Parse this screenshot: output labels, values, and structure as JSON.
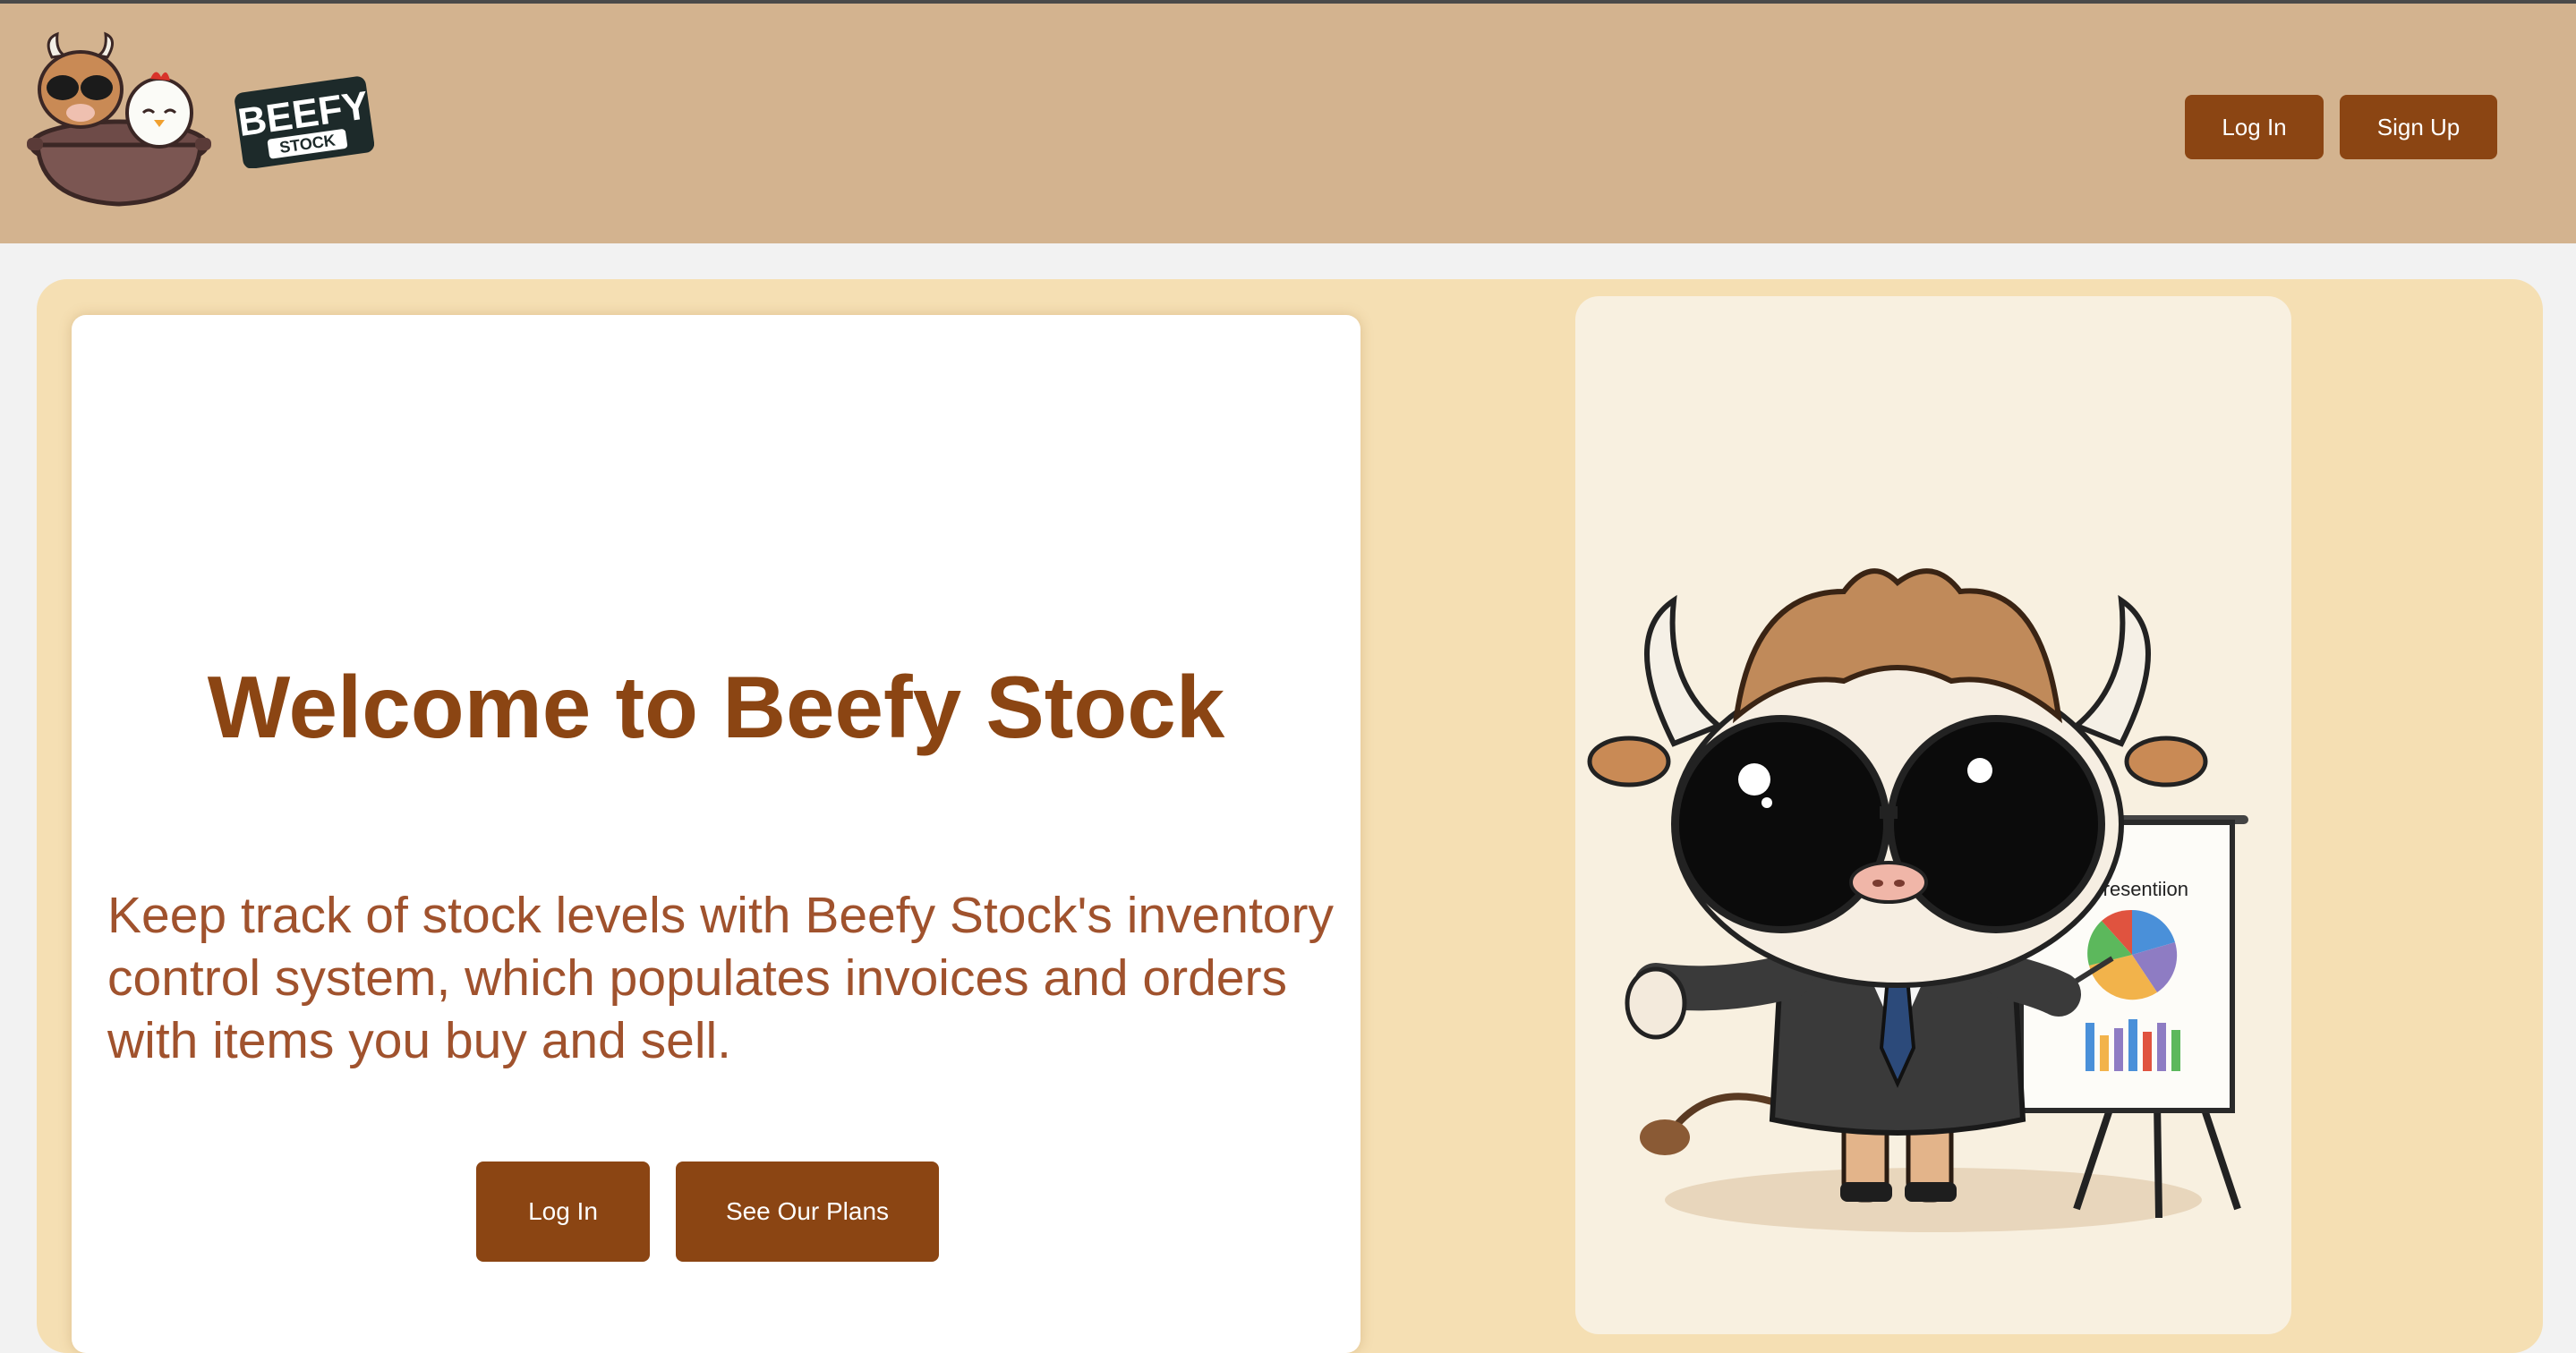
{
  "header": {
    "brand_word_1": "BEEFY",
    "brand_word_2": "STOCK",
    "login_label": "Log In",
    "signup_label": "Sign Up"
  },
  "hero": {
    "title": "Welcome to Beefy Stock",
    "description": "Keep track of stock levels with Beefy Stock's inventory control system, which populates invoices and orders with items you buy and sell.",
    "login_label": "Log In",
    "plans_label": "See Our Plans"
  },
  "illustration": {
    "board_title": "Presentiion"
  },
  "colors": {
    "header_bg": "#d3b38f",
    "accent": "#8b4513",
    "hero_bg": "#f5dfb3",
    "subtitle": "#a0522d"
  }
}
